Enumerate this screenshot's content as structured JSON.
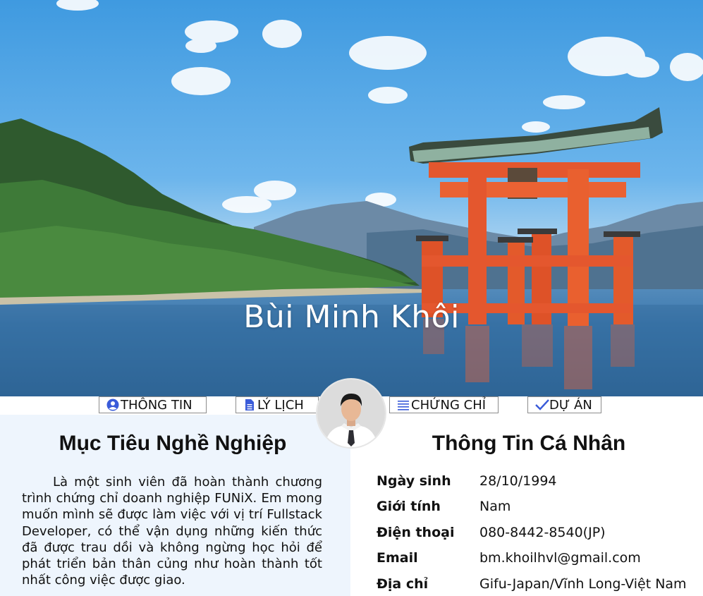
{
  "hero": {
    "name": "Bùi Minh Khôi",
    "image": "torii-gate-landscape"
  },
  "nav": {
    "items": [
      {
        "label": "THÔNG TIN",
        "icon": "user-circle-icon"
      },
      {
        "label": "LÝ LỊCH",
        "icon": "file-icon"
      },
      {
        "label": "CHỨNG CHỈ",
        "icon": "list-icon"
      },
      {
        "label": "DỰ ÁN",
        "icon": "check-icon"
      }
    ]
  },
  "avatar": {
    "alt": "profile-photo"
  },
  "objective": {
    "title": "Mục Tiêu Nghề Nghiệp",
    "text": "Là một sinh viên đã hoàn thành chương trình chứng chỉ doanh nghiệp FUNiX. Em mong muốn mình sẽ được làm việc với vị trí Fullstack Developer, có thể vận dụng những kiến thức đã được trau dồi và không ngừng học hỏi để phát triển bản thân củng như hoàn thành tốt nhất công việc được giao."
  },
  "personal": {
    "title": "Thông Tin Cá Nhân",
    "rows": [
      {
        "label": "Ngày sinh",
        "value": "28/10/1994"
      },
      {
        "label": "Giới tính",
        "value": "Nam"
      },
      {
        "label": "Điện thoại",
        "value": "080-8442-8540(JP)"
      },
      {
        "label": "Email",
        "value": "bm.khoilhvl@gmail.com"
      },
      {
        "label": "Địa chỉ",
        "value": "Gifu-Japan/Vĩnh Long-Việt Nam"
      }
    ]
  },
  "colors": {
    "accent": "#3a5bd9",
    "left_panel_bg": "#eef5fd",
    "torii": "#e4572e"
  }
}
